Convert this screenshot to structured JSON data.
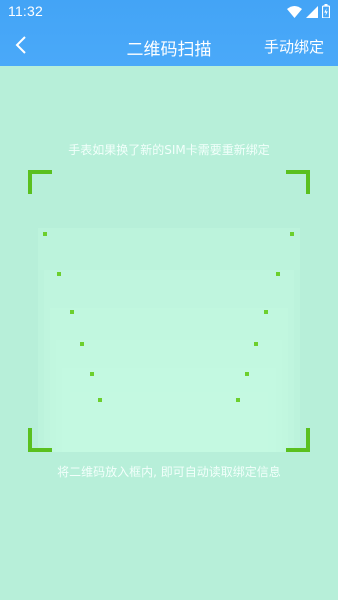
{
  "status_bar": {
    "time": "11:32",
    "icons": [
      "wifi-icon",
      "signal-icon",
      "battery-icon"
    ]
  },
  "nav": {
    "back_icon": "chevron-left-icon",
    "title": "二维码扫描",
    "manual_bind": "手动绑定"
  },
  "scanner": {
    "notice": "手表如果换了新的SIM卡需要重新绑定",
    "hint": "将二维码放入框内, 即可自动读取绑定信息"
  },
  "colors": {
    "header": "#43a4f6",
    "background": "#b7efd9",
    "corner": "#5ac01f"
  }
}
